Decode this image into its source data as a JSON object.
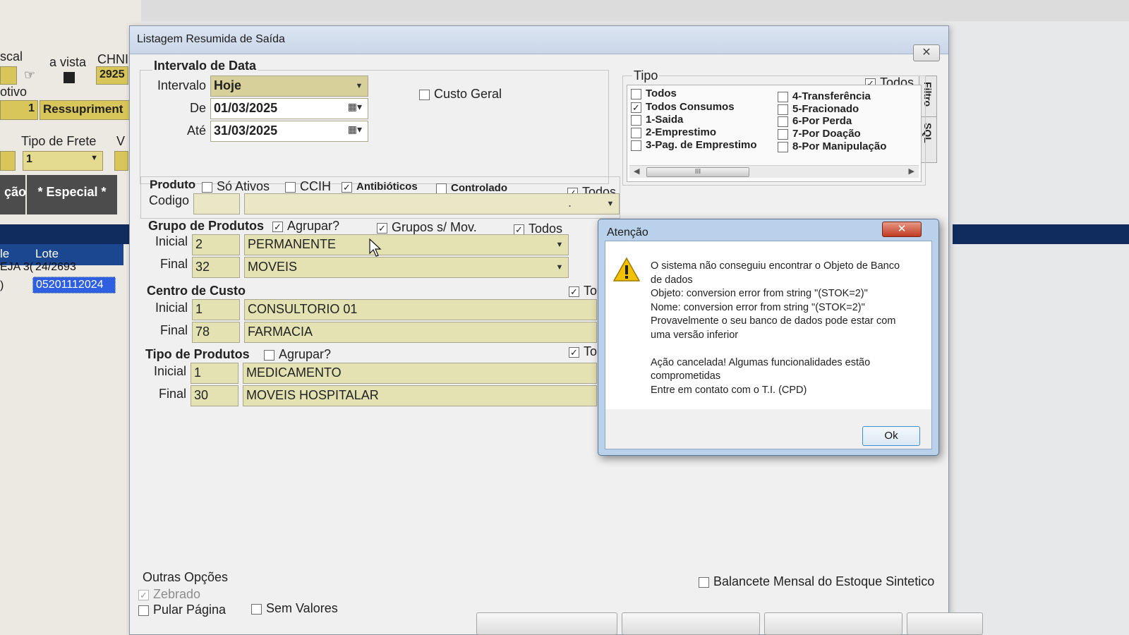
{
  "background_app": {
    "labels": {
      "fiscal": "scal",
      "a_vista": "a vista",
      "chn": "CHNI",
      "motivo": "otivo",
      "tipo_frete": "Tipo de Frete",
      "v": "V"
    },
    "fields": {
      "num_2925": "2925",
      "motivo_code": "1",
      "motivo_value": "Ressupriment",
      "frete_value": "1"
    },
    "tabs": {
      "cao": "ção",
      "especial": "* Especial *"
    },
    "grid": {
      "headers": [
        "le",
        "Lote"
      ],
      "rows": [
        [
          "EJA 3(",
          "24/2693"
        ],
        [
          ")",
          "05201112024"
        ]
      ]
    },
    "colors": {
      "band": "#102c5e",
      "selected": "#2d5fe0",
      "field_yellow": "#d8c65a"
    }
  },
  "window": {
    "title": "Listagem Resumida de Saída",
    "close_label": "✕",
    "side_tabs": [
      "Filtro",
      "SQL"
    ],
    "intervalo_data": {
      "title": "Intervalo de Data",
      "intervalo_label": "Intervalo",
      "intervalo_value": "Hoje",
      "de_label": "De",
      "de_value": "01/03/2025",
      "ate_label": "Até",
      "ate_value": "31/03/2025",
      "custo_geral": "Custo Geral"
    },
    "tipo": {
      "title": "Tipo",
      "todos_label": "Todos",
      "items_left": [
        {
          "label": "Todos",
          "checked": false
        },
        {
          "label": "Todos Consumos",
          "checked": true
        },
        {
          "label": "1-Saida",
          "checked": false
        },
        {
          "label": "2-Emprestimo",
          "checked": false
        },
        {
          "label": "3-Pag. de Emprestimo",
          "checked": false
        }
      ],
      "items_right": [
        {
          "label": "4-Transferência",
          "checked": false
        },
        {
          "label": "5-Fracionado",
          "checked": false
        },
        {
          "label": "6-Por Perda",
          "checked": false
        },
        {
          "label": "7-Por Doação",
          "checked": false
        },
        {
          "label": "8-Por Manipulação",
          "checked": false
        }
      ],
      "scroll_thumb": "III"
    },
    "produto": {
      "label": "Produto",
      "so_ativos": "Só Ativos",
      "ccih": "CCIH",
      "antibioticos": "Antibióticos",
      "controlado": "Controlado",
      "todos": "Todos",
      "codigo_label": "Codigo",
      "codigo_dot": "."
    },
    "grupo_produtos": {
      "title": "Grupo de Produtos",
      "agrupar": "Agrupar?",
      "grupos_sem_mov": "Grupos s/ Mov.",
      "todos": "Todos",
      "inicial_label": "Inicial",
      "inicial_code": "2",
      "inicial_name": "PERMANENTE",
      "final_label": "Final",
      "final_code": "32",
      "final_name": "MOVEIS"
    },
    "centro_custo": {
      "title": "Centro de Custo",
      "todos": "To",
      "inicial_label": "Inicial",
      "inicial_code": "1",
      "inicial_name": "CONSULTORIO 01",
      "final_label": "Final",
      "final_code": "78",
      "final_name": "FARMACIA"
    },
    "tipo_produtos": {
      "title": "Tipo de Produtos",
      "agrupar": "Agrupar?",
      "todos": "To",
      "inicial_label": "Inicial",
      "inicial_code": "1",
      "inicial_name": "MEDICAMENTO",
      "final_label": "Final",
      "final_code": "30",
      "final_name": "MOVEIS HOSPITALAR"
    },
    "outras_opcoes": {
      "title": "Outras Opções",
      "zebrado": "Zebrado",
      "pular_pagina": "Pular Página",
      "sem_valores": "Sem Valores",
      "balancete": "Balancete Mensal do Estoque Sintetico"
    }
  },
  "dialog": {
    "title": "Atenção",
    "close_label": "✕",
    "message": "O sistema não conseguiu encontrar o Objeto de Banco\nde dados\nObjeto: conversion error from string \"(STOK=2)\"\nNome: conversion error from string \"(STOK=2)\"\nProvavelmente o seu banco de dados pode estar com\numa versão inferior\n\nAção cancelada! Algumas funcionalidades estão\ncomprometidas\nEntre em contato com o T.I. (CPD)",
    "ok_label": "Ok"
  }
}
